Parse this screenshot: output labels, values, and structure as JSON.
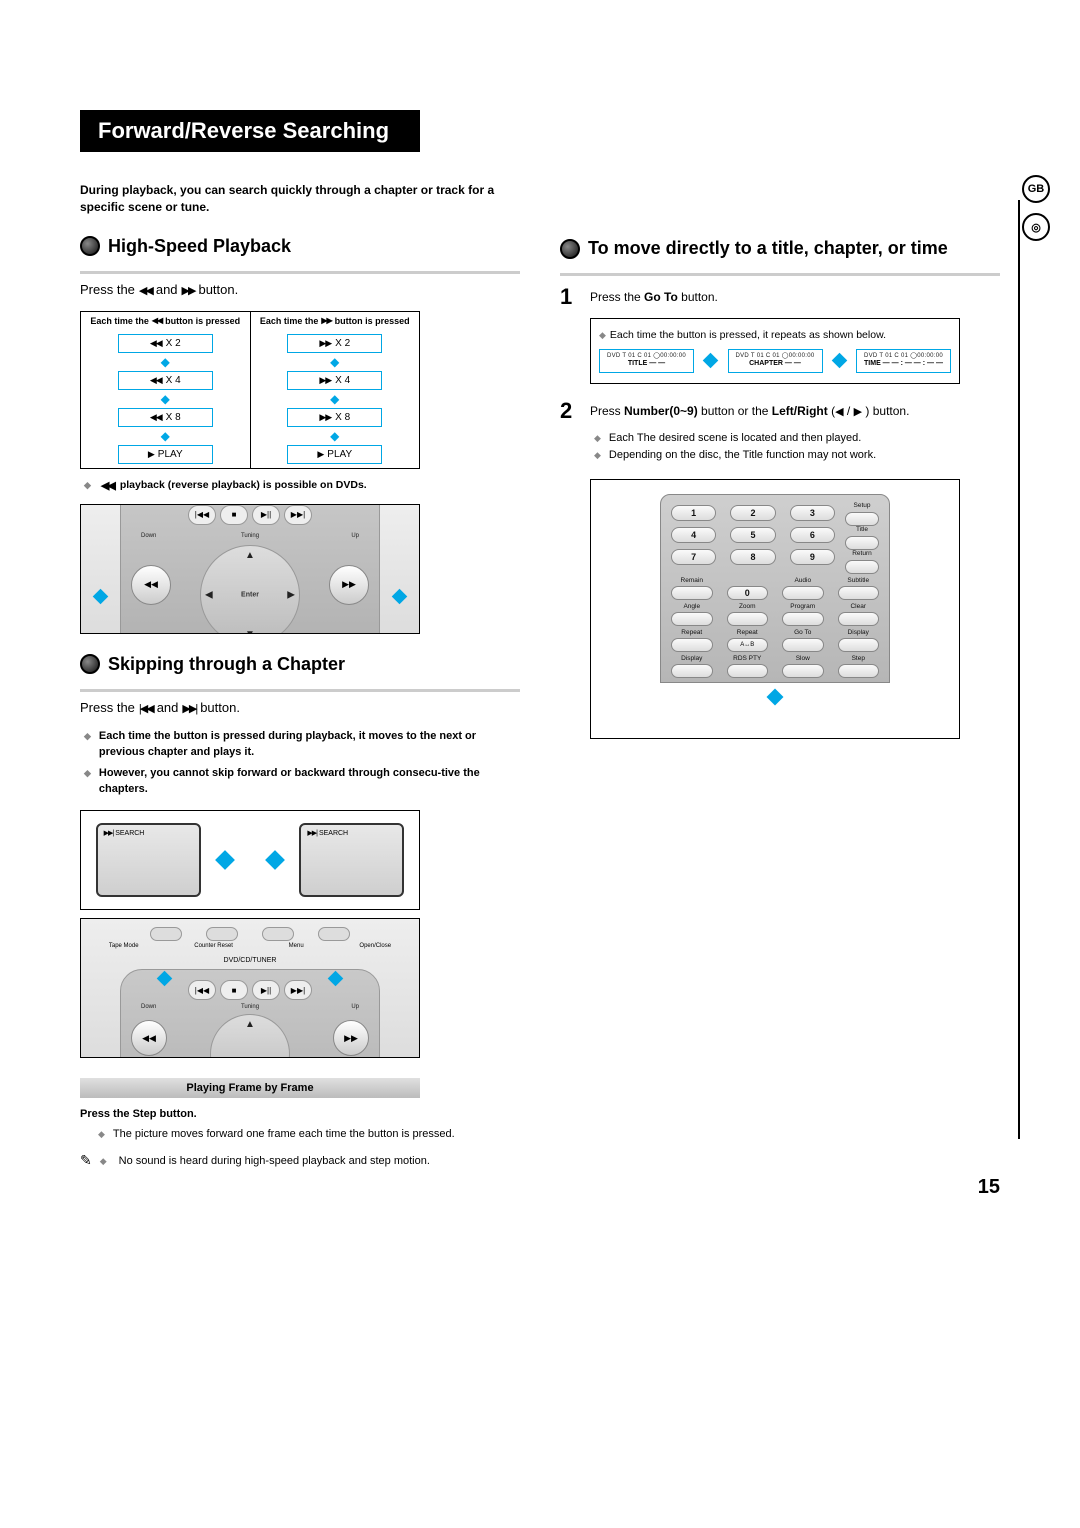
{
  "page_title": "Forward/Reverse Searching",
  "side_badges": {
    "lang": "GB",
    "disc": "◎"
  },
  "intro": "During playback, you can search quickly through a chapter or track for a specific scene or tune.",
  "left": {
    "highspeed": {
      "heading": "High-Speed Playback",
      "instruction_pre": "Press the",
      "instruction_mid": "and",
      "instruction_post": "button.",
      "col_hdr_prefix": "Each time the",
      "col_hdr_suffix": "button is pressed",
      "rev": [
        "X 2",
        "X 4",
        "X 8",
        "PLAY"
      ],
      "fwd": [
        "X 2",
        "X 4",
        "X 8",
        "PLAY"
      ],
      "note": "playback (reverse playback) is possible on DVDs.",
      "remote_labels": {
        "down": "Down",
        "tuning": "Tuning",
        "up": "Up",
        "enter": "Enter"
      }
    },
    "skip": {
      "heading": "Skipping through a Chapter",
      "instruction_pre": "Press the",
      "instruction_mid": "and",
      "instruction_post": "button.",
      "bullet1": "Each time the button is pressed during playback, it moves to the next or previous chapter and plays it.",
      "bullet2": "However, you cannot skip forward or backward through consecu-tive the chapters.",
      "search_label": "SEARCH",
      "top_btn_labels": [
        "Tape Mode",
        "Counter Reset",
        "Menu",
        "Open/Close"
      ],
      "inner_label": "DVD/CD/TUNER",
      "remote_labels": {
        "down": "Down",
        "tuning": "Tuning",
        "up": "Up"
      }
    },
    "frame": {
      "bar": "Playing Frame by Frame",
      "instruction": "Press the Step button.",
      "note": "The picture moves forward one frame each time the button is pressed.",
      "sound_note": "No sound is heard during high-speed playback and step motion."
    }
  },
  "right": {
    "heading": "To move directly to a title, chapter, or time",
    "step1": {
      "num": "1",
      "text_pre": "Press the ",
      "text_bold": "Go To",
      "text_post": " button.",
      "box_note": "Each time the button is pressed, it repeats as shown below.",
      "states": [
        {
          "top": "DVD   T 01   C 01   ◯00:00:00",
          "bottom": "TITLE  — —"
        },
        {
          "top": "DVD   T 01   C 01   ◯00:00:00",
          "bottom": "CHAPTER  — —"
        },
        {
          "top": "DVD   T 01   C 01   ◯00:00:00",
          "bottom": "TIME — — : — — : — —"
        }
      ]
    },
    "step2": {
      "num": "2",
      "text_pre": "Press ",
      "text_b1": "Number(0~9)",
      "text_mid": " button or the ",
      "text_b2": "Left/Right",
      "text_paren_open": " (",
      "text_paren_close": " ) button.",
      "sub1": "Each The desired scene is located and then played.",
      "sub2": "Depending on the disc, the Title function may not work."
    },
    "remote": {
      "numbers": [
        "1",
        "2",
        "3",
        "4",
        "5",
        "6",
        "7",
        "8",
        "9",
        "0"
      ],
      "side_labels_r": [
        "Setup",
        "Title",
        "Return",
        "Subtitle",
        "Clear",
        "Display",
        "Step"
      ],
      "row_labels": [
        [
          "Remain",
          "",
          "Audio",
          "Subtitle"
        ],
        [
          "Angle",
          "Zoom",
          "Program",
          "Clear"
        ],
        [
          "Repeat",
          "Repeat",
          "Go To",
          "Display"
        ],
        [
          "Display",
          "RDS   PTY",
          "Slow",
          "Step"
        ]
      ],
      "ab_label": "A↔B"
    }
  },
  "page_number": "15"
}
